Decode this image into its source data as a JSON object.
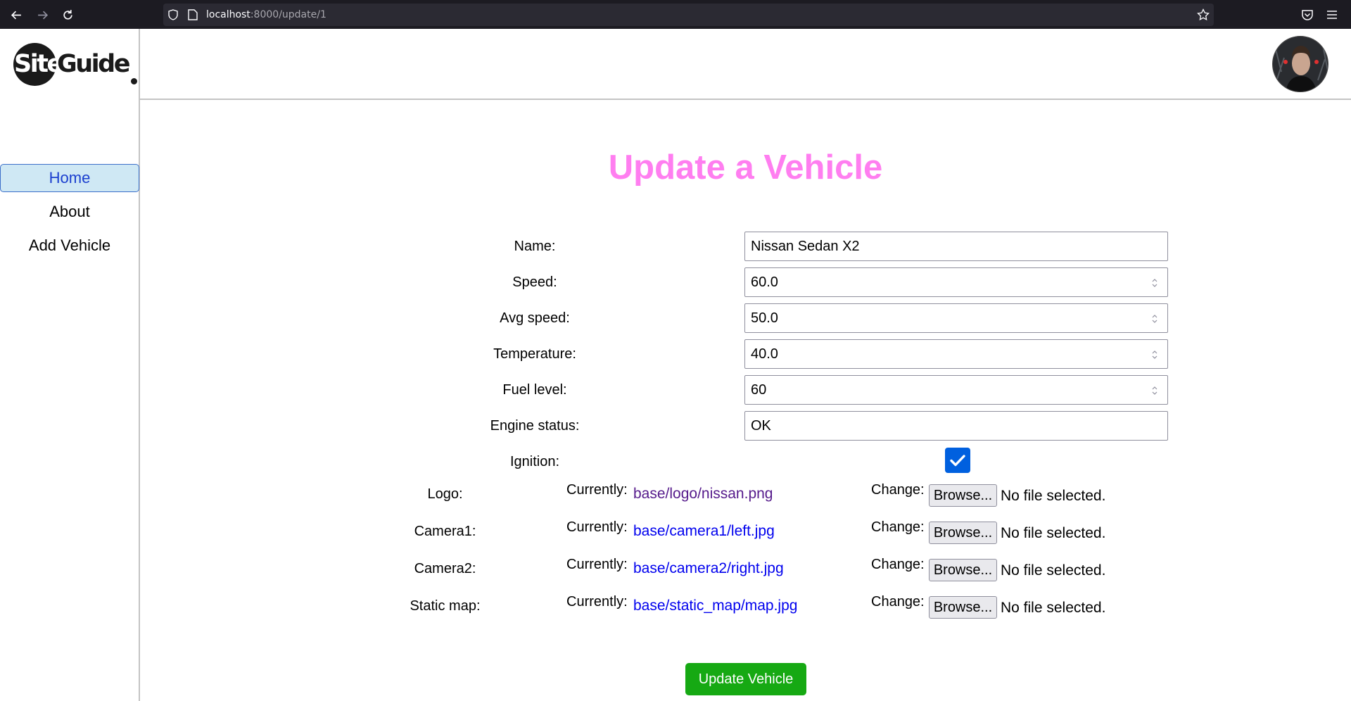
{
  "browser": {
    "url_host": "localhost",
    "url_rest": ":8000/update/1"
  },
  "brand": {
    "site": "Site",
    "guide": "Guide"
  },
  "sidebar": {
    "items": [
      {
        "label": "Home",
        "active": true
      },
      {
        "label": "About",
        "active": false
      },
      {
        "label": "Add Vehicle",
        "active": false
      }
    ]
  },
  "page": {
    "title": "Update a Vehicle"
  },
  "form": {
    "name": {
      "label": "Name:",
      "value": "Nissan Sedan X2"
    },
    "speed": {
      "label": "Speed:",
      "value": "60.0"
    },
    "avg_speed": {
      "label": "Avg speed:",
      "value": "50.0"
    },
    "temperature": {
      "label": "Temperature:",
      "value": "40.0"
    },
    "fuel_level": {
      "label": "Fuel level:",
      "value": "60"
    },
    "engine_status": {
      "label": "Engine status:",
      "value": "OK"
    },
    "ignition": {
      "label": "Ignition:",
      "checked": true
    },
    "files": {
      "currently_label": "Currently:",
      "change_label": "Change:",
      "browse_label": "Browse...",
      "no_file_text": "No file selected.",
      "logo": {
        "label": "Logo:",
        "path": "base/logo/nissan.png"
      },
      "camera1": {
        "label": "Camera1:",
        "path": "base/camera1/left.jpg"
      },
      "camera2": {
        "label": "Camera2:",
        "path": "base/camera2/right.jpg"
      },
      "static_map": {
        "label": "Static map:",
        "path": "base/static_map/map.jpg"
      }
    },
    "submit_label": "Update Vehicle"
  },
  "colors": {
    "title": "#ff7ef0",
    "submit": "#16a913",
    "active_nav_bg": "#cfe8f4",
    "link": "#0000ee",
    "visited_link": "#551a8b",
    "checkbox": "#0060df"
  }
}
